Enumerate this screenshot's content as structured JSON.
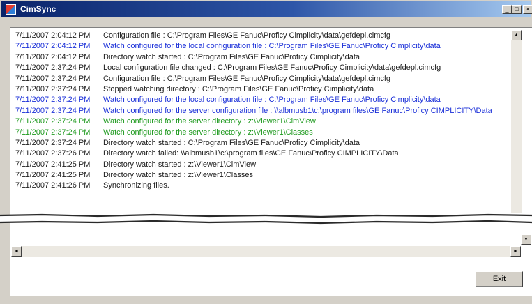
{
  "window": {
    "title": "CimSync",
    "icon": "cimsync-app-icon"
  },
  "controls": {
    "minimize": "_",
    "maximize": "□",
    "close": "×"
  },
  "colors": {
    "info": "#202020",
    "local_watch": "#1a2fd8",
    "server_watch": "#1f9a1f"
  },
  "log": [
    {
      "time": "7/11/2007  2:04:12 PM",
      "msg": "Configuration file : C:\\Program Files\\GE Fanuc\\Proficy Cimplicity\\data\\gefdepl.cimcfg",
      "kind": "info"
    },
    {
      "time": "7/11/2007  2:04:12 PM",
      "msg": "Watch configured for the local configuration file : C:\\Program Files\\GE Fanuc\\Proficy Cimplicity\\data",
      "kind": "local_watch"
    },
    {
      "time": "7/11/2007  2:04:12 PM",
      "msg": "Directory watch started : C:\\Program Files\\GE Fanuc\\Proficy Cimplicity\\data",
      "kind": "info"
    },
    {
      "time": "7/11/2007  2:37:24 PM",
      "msg": "Local configuration file changed : C:\\Program Files\\GE Fanuc\\Proficy Cimplicity\\data\\gefdepl.cimcfg",
      "kind": "info"
    },
    {
      "time": "7/11/2007  2:37:24 PM",
      "msg": "Configuration file : C:\\Program Files\\GE Fanuc\\Proficy Cimplicity\\data\\gefdepl.cimcfg",
      "kind": "info"
    },
    {
      "time": "7/11/2007  2:37:24 PM",
      "msg": "Stopped watching directory : C:\\Program Files\\GE Fanuc\\Proficy Cimplicity\\data",
      "kind": "info"
    },
    {
      "time": "7/11/2007  2:37:24 PM",
      "msg": "Watch configured for the local configuration file : C:\\Program Files\\GE Fanuc\\Proficy Cimplicity\\data",
      "kind": "local_watch"
    },
    {
      "time": "7/11/2007  2:37:24 PM",
      "msg": "Watch configured for the server configuration file : \\\\albmusb1\\c:\\program files\\GE Fanuc\\Proficy CIMPLICITY\\Data",
      "kind": "local_watch"
    },
    {
      "time": "7/11/2007  2:37:24 PM",
      "msg": "Watch configured for the server directory : z:\\Viewer1\\CimView",
      "kind": "server_watch"
    },
    {
      "time": "7/11/2007  2:37:24 PM",
      "msg": "Watch configured for the server directory : z:\\Viewer1\\Classes",
      "kind": "server_watch"
    },
    {
      "time": "7/11/2007  2:37:24 PM",
      "msg": "Directory watch started : C:\\Program Files\\GE Fanuc\\Proficy Cimplicity\\data",
      "kind": "info"
    },
    {
      "time": "7/11/2007  2:37:26 PM",
      "msg": "Directory watch failed: \\\\albmusb1\\c:\\program files\\GE Fanuc\\Proficy CIMPLICITY\\Data",
      "kind": "info"
    },
    {
      "time": "7/11/2007  2:41:25 PM",
      "msg": "Directory watch started : z:\\Viewer1\\CimView",
      "kind": "info"
    },
    {
      "time": "7/11/2007  2:41:25 PM",
      "msg": "Directory watch started : z:\\Viewer1\\Classes",
      "kind": "info"
    },
    {
      "time": "7/11/2007  2:41:26 PM",
      "msg": "Synchronizing files.",
      "kind": "info"
    }
  ],
  "scroll": {
    "up": "▲",
    "down": "▼",
    "left": "◄",
    "right": "►"
  },
  "buttons": {
    "exit": "Exit"
  }
}
